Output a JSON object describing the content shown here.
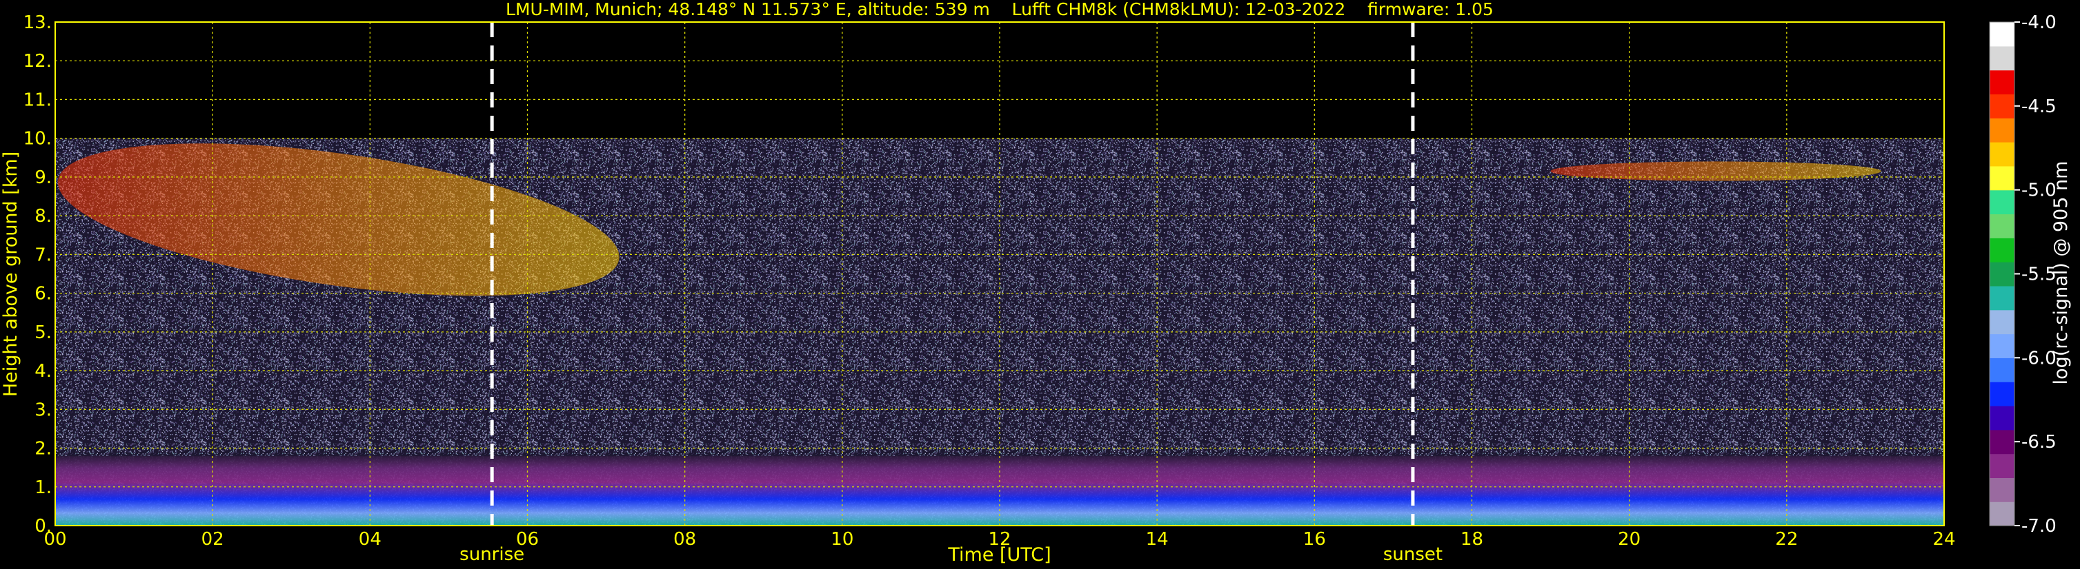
{
  "chart_data": {
    "type": "heatmap",
    "title": "LMU-MIM, Munich; 48.148° N 11.573° E, altitude: 539 m    Lufft CHM8k (CHM8kLMU): 12-03-2022    firmware: 1.05",
    "xlabel": "Time [UTC]",
    "ylabel": "Height above ground [km]",
    "xlim": [
      0,
      24
    ],
    "ylim": [
      0,
      13
    ],
    "x_ticks": [
      "00",
      "02",
      "04",
      "06",
      "08",
      "10",
      "12",
      "14",
      "16",
      "18",
      "20",
      "22",
      "24"
    ],
    "y_ticks": [
      "0.",
      "1.",
      "2.",
      "3.",
      "4.",
      "5.",
      "6.",
      "7.",
      "8.",
      "9.",
      "10.",
      "11.",
      "12.",
      "13."
    ],
    "grid": true,
    "events": [
      {
        "label": "sunrise",
        "time": 5.55
      },
      {
        "label": "sunset",
        "time": 17.25
      }
    ],
    "data_top_km": 10,
    "layers": [
      {
        "name": "boundary layer",
        "time_start": 0,
        "time_end": 24,
        "height_bottom": 0.0,
        "height_top": 1.8,
        "level": -6.5
      },
      {
        "name": "upper cloud",
        "time_start": 0,
        "time_end": 7.2,
        "height_bottom": 6.2,
        "height_top": 9.6,
        "level": -5.4
      },
      {
        "name": "upper cloud",
        "time_start": 19.0,
        "time_end": 23.2,
        "height_bottom": 8.9,
        "height_top": 9.4,
        "level": -5.3
      }
    ],
    "colorbar": {
      "label": "log(rc-signal) @ 905 nm",
      "min": -7.0,
      "max": -4.0,
      "ticks": [
        "-4.0",
        "-4.5",
        "-5.0",
        "-5.5",
        "-6.0",
        "-6.5",
        "-7.0"
      ],
      "colors": [
        "#a89bb6",
        "#9a6aa0",
        "#8a2a8a",
        "#6a006f",
        "#3a00b8",
        "#0a2aff",
        "#3a7aff",
        "#7aa8ff",
        "#9ab8e8",
        "#22b8a8",
        "#16a050",
        "#10c020",
        "#6cd86c",
        "#30e090",
        "#ffff30",
        "#ffcc00",
        "#ff8800",
        "#ff3300",
        "#ee0000",
        "#d8d8d8",
        "#ffffff"
      ]
    },
    "colors": {
      "background": "#000000",
      "text": "#ffff00",
      "grid": "#d8d800",
      "event_line": "#ffffff",
      "colorbar_text": "#ffffff"
    }
  }
}
